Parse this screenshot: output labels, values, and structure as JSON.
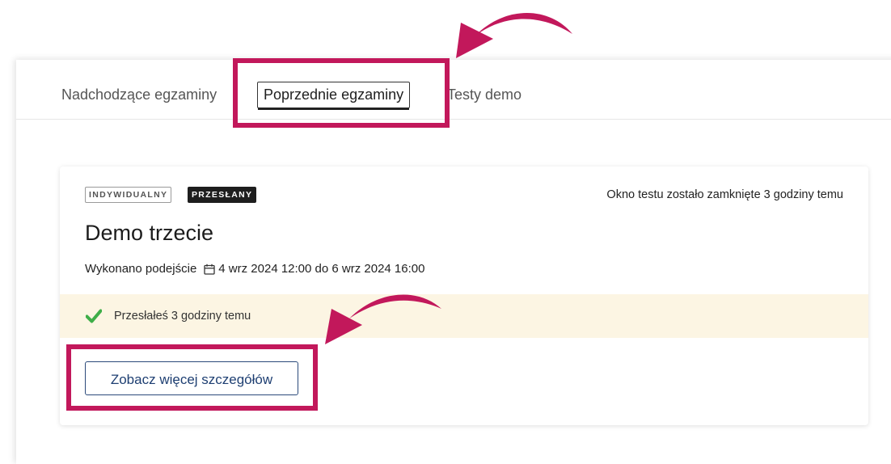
{
  "tabs": [
    {
      "label": "Nadchodzące egzaminy",
      "active": false
    },
    {
      "label": "Poprzednie egzaminy",
      "active": true
    },
    {
      "label": "Testy demo",
      "active": false
    }
  ],
  "card": {
    "badges": [
      "INDYWIDUALNY",
      "PRZESŁANY"
    ],
    "closed_note": "Okno testu zostało zamknięte 3 godziny temu",
    "title": "Demo trzecie",
    "attempt_label": "Wykonano podejście",
    "attempt_range": "4 wrz 2024 12:00 do 6 wrz 2024 16:00",
    "notice": "Przesłałeś 3 godziny temu",
    "details_button": "Zobacz więcej szczegółów"
  },
  "icons": {
    "calendar": "calendar-icon",
    "check": "check-icon",
    "annotation_arrow": "curved-arrow"
  },
  "colors": {
    "annotation": "#c2185b",
    "success": "#3fae49",
    "notice_bg": "#fcf5e3",
    "button_text": "#1e3f72"
  }
}
